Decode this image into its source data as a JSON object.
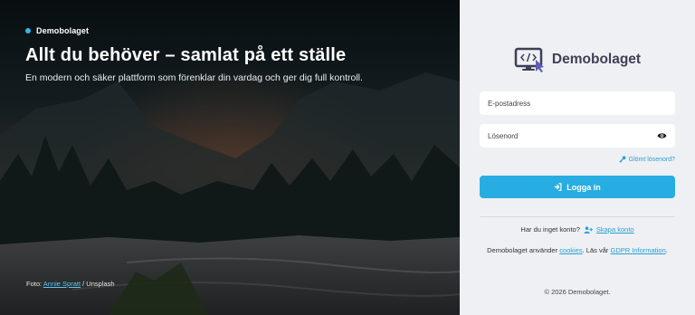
{
  "hero": {
    "brand": "Demobolaget",
    "headline": "Allt du behöver – samlat på ett ställe",
    "subtitle": "En modern och säker plattform som förenklar din vardag och ger dig full kontroll.",
    "credit": {
      "prefix": "Foto:",
      "author": "Annie Spratt",
      "suffix": "/ Unsplash"
    }
  },
  "logo": {
    "text": "Demobolaget",
    "icon": "monitor-code-icon"
  },
  "form": {
    "email_placeholder": "E-postadress",
    "password_placeholder": "Lösenord",
    "forgot_label": "Glömt lösenord?",
    "login_label": "Logga in"
  },
  "signup": {
    "question": "Har du inget konto?",
    "link": "Skapa konto"
  },
  "cookies": {
    "prefix": "Demobolaget använder",
    "cookies_link": "cookies",
    "mid": ". Läs vår",
    "gdpr_link": "GDPR Information",
    "suffix": "."
  },
  "footer": {
    "copyright": "© 2026 Demobolaget."
  },
  "colors": {
    "accent": "#27ade2",
    "link": "#2a9fd6",
    "panel_bg": "#eef0f3",
    "logo_text": "#3d4156"
  }
}
